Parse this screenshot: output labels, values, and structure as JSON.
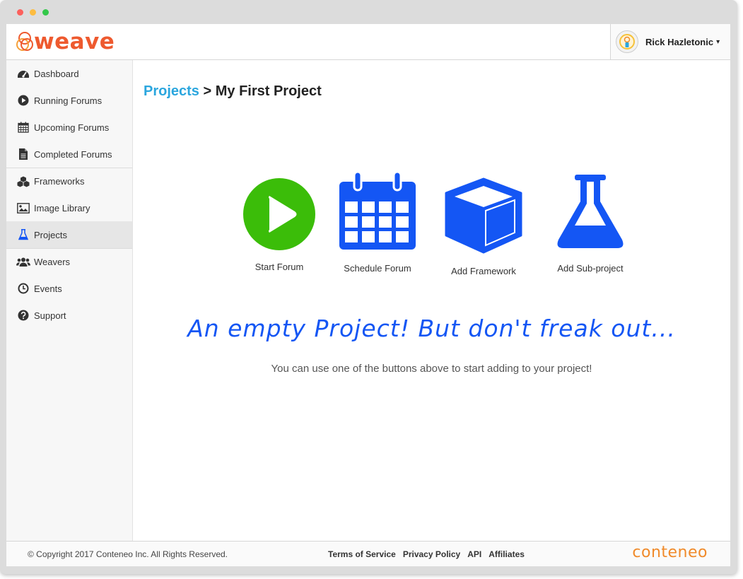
{
  "app": {
    "name": "weave",
    "brand_color": "#ee5a2f"
  },
  "user": {
    "name": "Rick Hazletonic",
    "caret": "▾"
  },
  "sidebar": {
    "items": [
      {
        "label": "Dashboard",
        "icon": "dashboard-gauge-icon"
      },
      {
        "label": "Running Forums",
        "icon": "play-circle-icon"
      },
      {
        "label": "Upcoming Forums",
        "icon": "calendar-icon"
      },
      {
        "label": "Completed Forums",
        "icon": "document-icon"
      },
      {
        "label": "Frameworks",
        "icon": "cubes-icon"
      },
      {
        "label": "Image Library",
        "icon": "image-icon"
      },
      {
        "label": "Projects",
        "icon": "flask-icon",
        "active": true
      },
      {
        "label": "Weavers",
        "icon": "users-icon"
      },
      {
        "label": "Events",
        "icon": "clock-icon"
      },
      {
        "label": "Support",
        "icon": "question-circle-icon"
      }
    ]
  },
  "breadcrumb": {
    "parent": "Projects",
    "separator": " > ",
    "current": "My First Project"
  },
  "actions": [
    {
      "label": "Start Forum",
      "icon": "play-circle-icon",
      "color": "#3bbd09"
    },
    {
      "label": "Schedule Forum",
      "icon": "calendar-icon",
      "color": "#1456f4"
    },
    {
      "label": "Add Framework",
      "icon": "cube-icon",
      "color": "#1456f4"
    },
    {
      "label": "Add Sub-project",
      "icon": "flask-icon",
      "color": "#1456f4"
    }
  ],
  "empty_state": {
    "heading": "An empty Project! But don't freak out...",
    "text": "You can use one of the buttons above to start adding to your project!"
  },
  "footer": {
    "copyright": "© Copyright 2017 Conteneo Inc. All Rights Reserved.",
    "links": [
      "Terms of Service",
      "Privacy Policy",
      "API",
      "Affiliates"
    ],
    "brand": "conteneo"
  }
}
